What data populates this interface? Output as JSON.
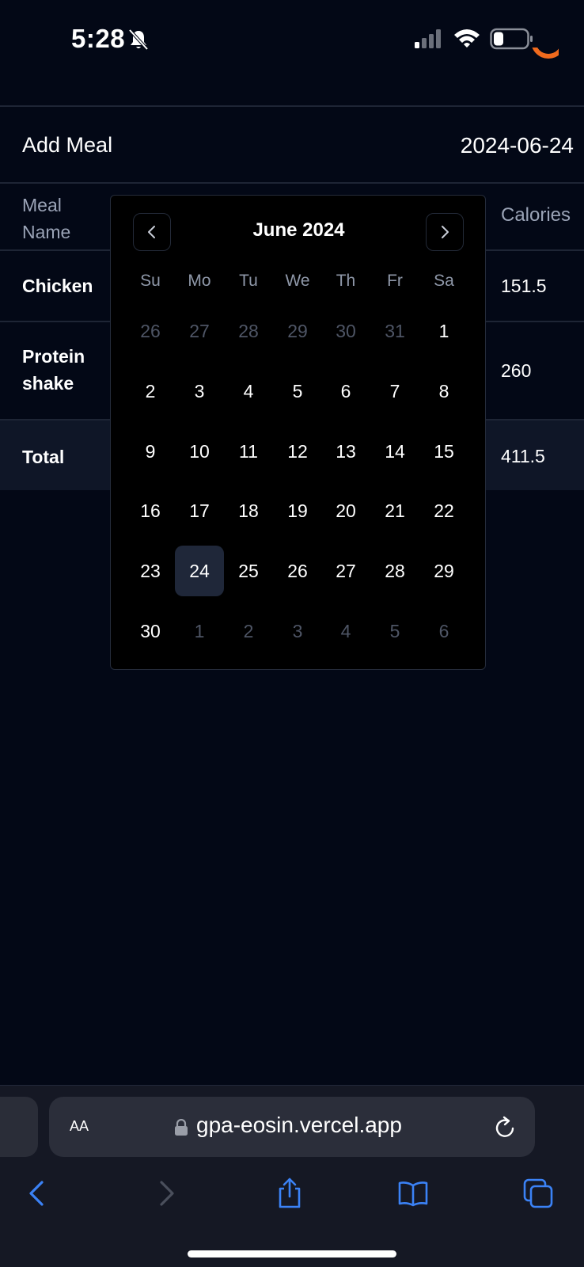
{
  "status_bar": {
    "time": "5:28",
    "icons": [
      "bell-slash-icon",
      "signal-icon",
      "wifi-icon",
      "battery-icon"
    ]
  },
  "page": {
    "title": "Add Meal",
    "date": "2024-06-24",
    "table": {
      "headers": {
        "meal_name": "Meal Name",
        "calories": "Calories"
      },
      "rows": [
        {
          "name": "Chicken",
          "calories": "151.5"
        },
        {
          "name": "Protein shake",
          "calories": "260"
        }
      ],
      "total": {
        "label": "Total",
        "calories": "411.5"
      }
    }
  },
  "calendar": {
    "month_label": "June 2024",
    "weekdays": [
      "Su",
      "Mo",
      "Tu",
      "We",
      "Th",
      "Fr",
      "Sa"
    ],
    "weeks": [
      [
        "26",
        "27",
        "28",
        "29",
        "30",
        "31",
        "1"
      ],
      [
        "2",
        "3",
        "4",
        "5",
        "6",
        "7",
        "8"
      ],
      [
        "9",
        "10",
        "11",
        "12",
        "13",
        "14",
        "15"
      ],
      [
        "16",
        "17",
        "18",
        "19",
        "20",
        "21",
        "22"
      ],
      [
        "23",
        "24",
        "25",
        "26",
        "27",
        "28",
        "29"
      ],
      [
        "30",
        "1",
        "2",
        "3",
        "4",
        "5",
        "6"
      ]
    ],
    "selected_day": "24",
    "icons": {
      "prev": "chevron-left-icon",
      "next": "chevron-right-icon"
    }
  },
  "browser": {
    "text_size_label": "AA",
    "url": "gpa-eosin.vercel.app",
    "icons": [
      "lock-icon",
      "reload-icon",
      "back-icon",
      "forward-icon",
      "share-icon",
      "bookmarks-icon",
      "tabs-icon"
    ]
  },
  "colors": {
    "background": "#030816",
    "accent_blue": "#3b82f6",
    "orange": "#f06a1d",
    "selected_day_bg": "#1f2739"
  }
}
